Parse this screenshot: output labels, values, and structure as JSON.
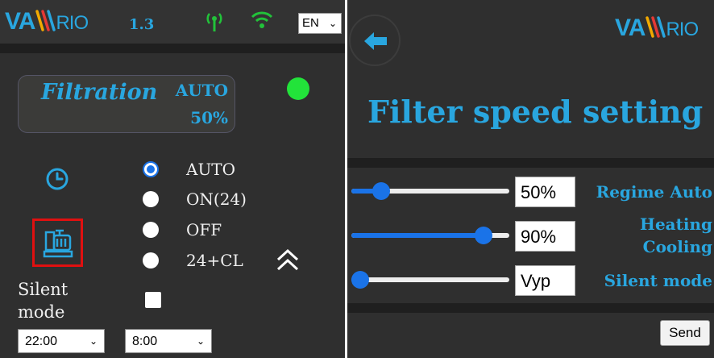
{
  "left": {
    "brand": {
      "va": "VA",
      "rio": "RIO"
    },
    "version": "1.3",
    "language": "EN",
    "filtration": {
      "title": "Filtration",
      "mode": "AUTO",
      "percent": "50%"
    },
    "status_color": "#22e33a",
    "modes": [
      {
        "label": "AUTO",
        "checked": true
      },
      {
        "label": "ON(24)",
        "checked": false
      },
      {
        "label": "OFF",
        "checked": false
      },
      {
        "label": "24+CL",
        "checked": false
      }
    ],
    "silent_mode_label": "Silent mode",
    "silent_mode_checked": false,
    "silent_from": "22:00",
    "silent_to": "8:00"
  },
  "right": {
    "brand": {
      "va": "VA",
      "rio": "RIO"
    },
    "title": "Filter speed setting",
    "rows": [
      {
        "value": "50%",
        "label": "Regime Auto",
        "level": 0.15
      },
      {
        "value": "90%",
        "label": "Heating Cooling",
        "level": 0.88
      },
      {
        "value": "Vyp",
        "label": "Silent mode",
        "level": 0.0
      }
    ],
    "send_label": "Send"
  },
  "colors": {
    "accent": "#29a6df",
    "background": "#2f2f2f",
    "slider": "#1a73e8",
    "highlight": "#e01010"
  }
}
